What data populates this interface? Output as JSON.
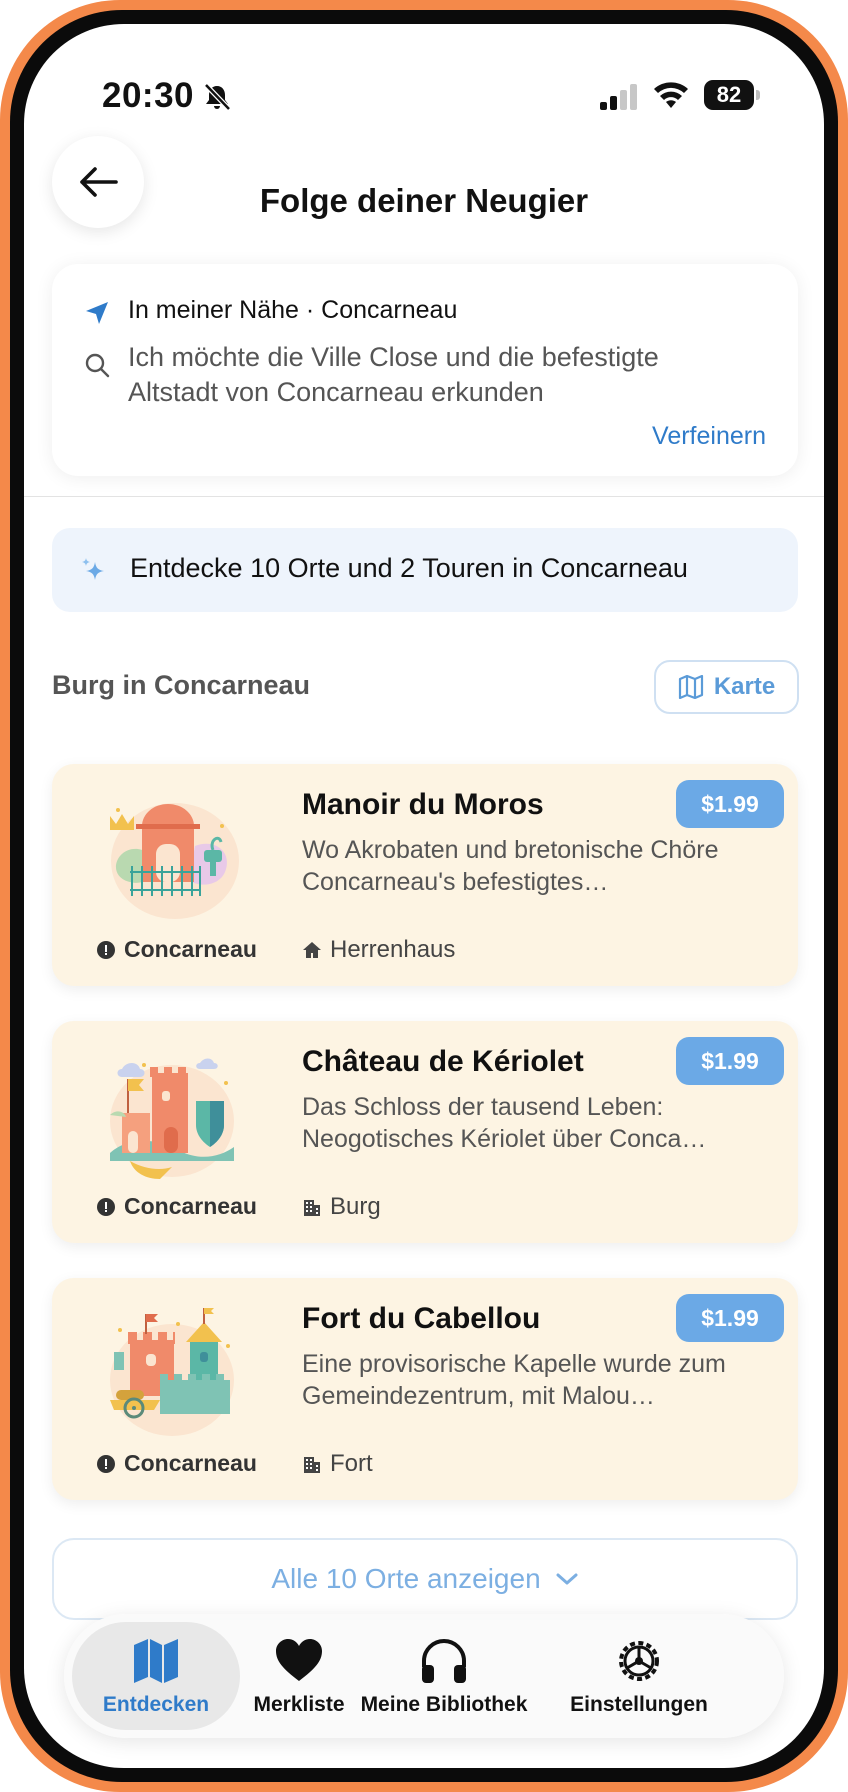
{
  "status_bar": {
    "time": "20:30",
    "battery": "82"
  },
  "header": {
    "title": "Folge deiner Neugier"
  },
  "search": {
    "location": "In meiner Nähe · Concarneau",
    "query": "Ich möchte die Ville Close und die befestigte Altstadt von Concarneau erkunden",
    "refine_label": "Verfeinern"
  },
  "discover_banner": "Entdecke 10 Orte und 2 Touren in Concarneau",
  "section": {
    "title": "Burg in Concarneau",
    "map_button": "Karte"
  },
  "places": [
    {
      "name": "Manoir du Moros",
      "price": "$1.99",
      "description": "Wo Akrobaten und bretonische Chöre Concarneau's befestigtes…",
      "location": "Concarneau",
      "category": "Herrenhaus",
      "category_icon": "house-icon"
    },
    {
      "name": "Château de Kériolet",
      "price": "$1.99",
      "description": "Das Schloss der tausend Leben: Neogotisches Kériolet über Conca…",
      "location": "Concarneau",
      "category": "Burg",
      "category_icon": "building-icon"
    },
    {
      "name": "Fort du Cabellou",
      "price": "$1.99",
      "description": "Eine provisorische Kapelle wurde zum Gemeindezentrum, mit Malou…",
      "location": "Concarneau",
      "category": "Fort",
      "category_icon": "building-icon"
    }
  ],
  "show_all_label": "Alle 10 Orte anzeigen",
  "tabs": [
    {
      "label": "Entdecken",
      "icon": "map-icon",
      "active": true
    },
    {
      "label": "Merkliste",
      "icon": "heart-icon",
      "active": false
    },
    {
      "label": "Meine Bibliothek",
      "icon": "headphones-icon",
      "active": false
    },
    {
      "label": "Einstellungen",
      "icon": "gear-icon",
      "active": false
    }
  ],
  "colors": {
    "frame": "#F4894A",
    "accent": "#2F7BC9",
    "card_bg": "#FDF4E3",
    "price_bg": "#6BA9E6",
    "banner_bg": "#EEF4FC"
  }
}
